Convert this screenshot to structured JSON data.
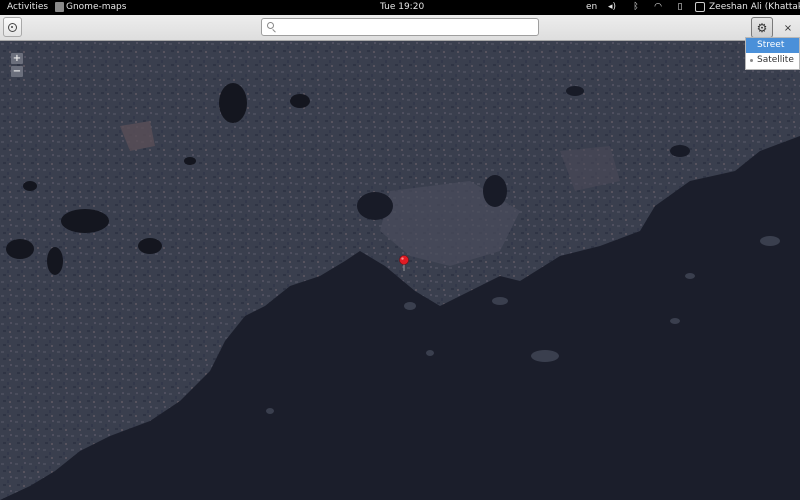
{
  "topbar": {
    "activities": "Activities",
    "app_name": "Gnome-maps",
    "clock": "Tue 19:20",
    "language": "en",
    "user_name": "Zeeshan Ali (Khattak)"
  },
  "headerbar": {
    "search_value": "",
    "close_glyph": "×"
  },
  "map": {
    "zoom_in": "+",
    "zoom_out": "−"
  },
  "layers": {
    "items": [
      {
        "label": "Street",
        "selected": true
      },
      {
        "label": "Satellite",
        "selected": false
      }
    ]
  },
  "colors": {
    "accent": "#4a90d9",
    "marker": "#e01b24",
    "water": "#1b1e2b",
    "land": "#3a3f4e"
  },
  "icons": [
    "locate-icon",
    "search-icon",
    "gear-icon",
    "close-icon",
    "volume-icon",
    "bluetooth-icon",
    "wifi-icon",
    "battery-icon",
    "user-icon",
    "map-marker-icon"
  ]
}
